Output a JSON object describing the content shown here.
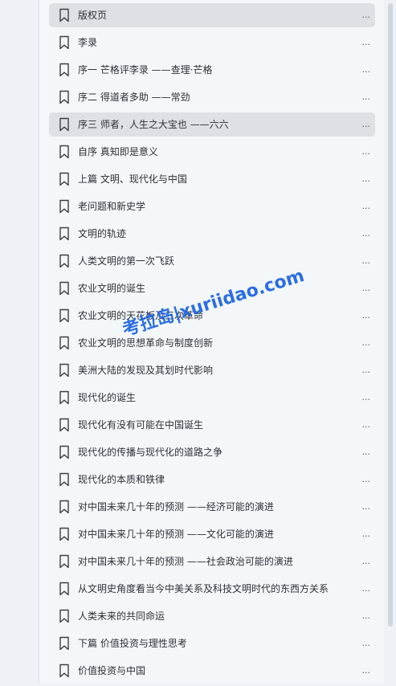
{
  "toc": {
    "items": [
      {
        "label": "版权页",
        "more": "...",
        "highlighted": true
      },
      {
        "label": "李录",
        "more": "..."
      },
      {
        "label": "序一 芒格评李录 ——查理·芒格",
        "more": "..."
      },
      {
        "label": "序二 得道者多助 ——常劲",
        "more": "..."
      },
      {
        "label": "序三 师者，人生之大宝也 ——六六",
        "more": "...",
        "highlighted": true
      },
      {
        "label": "自序 真知即是意义",
        "more": "..."
      },
      {
        "label": "上篇 文明、现代化与中国",
        "more": "..."
      },
      {
        "label": "老问题和新史学",
        "more": "..."
      },
      {
        "label": "文明的轨迹",
        "more": "..."
      },
      {
        "label": "人类文明的第一次飞跃",
        "more": "..."
      },
      {
        "label": "农业文明的诞生",
        "more": "..."
      },
      {
        "label": "农业文明的天花板及三次革命",
        "more": "..."
      },
      {
        "label": "农业文明的思想革命与制度创新",
        "more": "..."
      },
      {
        "label": "美洲大陆的发现及其划时代影响",
        "more": "..."
      },
      {
        "label": "现代化的诞生",
        "more": "..."
      },
      {
        "label": "现代化有没有可能在中国诞生",
        "more": "..."
      },
      {
        "label": "现代化的传播与现代化的道路之争",
        "more": "..."
      },
      {
        "label": "现代化的本质和铁律",
        "more": "..."
      },
      {
        "label": "对中国未来几十年的预测 ——经济可能的演进",
        "more": "..."
      },
      {
        "label": "对中国未来几十年的预测 ——文化可能的演进",
        "more": "..."
      },
      {
        "label": "对中国未来几十年的预测 ——社会政治可能的演进",
        "more": "..."
      },
      {
        "label": "从文明史角度看当今中美关系及科技文明时代的东西方关系",
        "more": "..."
      },
      {
        "label": "人类未来的共同命运",
        "more": "..."
      },
      {
        "label": "下篇 价值投资与理性思考",
        "more": "..."
      },
      {
        "label": "价值投资与中国",
        "more": "..."
      }
    ]
  },
  "watermark": {
    "text": "考拉岛|xuriidao.com",
    "color": "#1a63e0"
  },
  "colors": {
    "highlight": "#dde1e5",
    "panel": "#f4f7fa",
    "text": "#2c3138"
  },
  "icons": {
    "item_icon": "bookmark-icon"
  }
}
